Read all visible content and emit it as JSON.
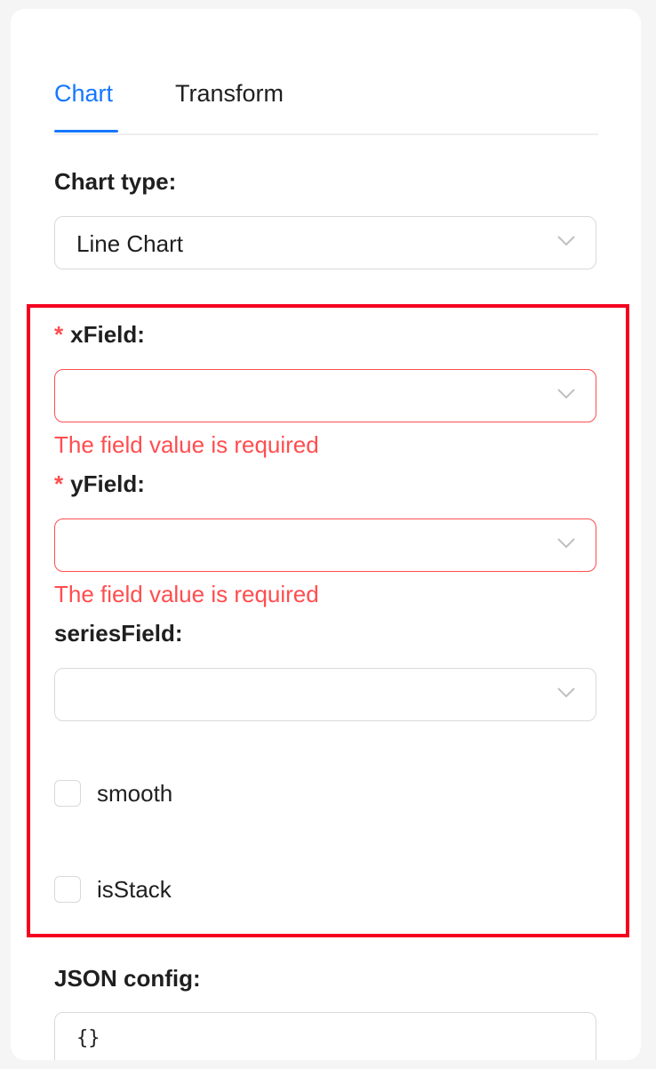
{
  "tabs": [
    {
      "label": "Chart",
      "active": true
    },
    {
      "label": "Transform",
      "active": false
    }
  ],
  "chart_type": {
    "label": "Chart type",
    "colon": ":",
    "value": "Line Chart"
  },
  "x_field": {
    "required_mark": "*",
    "label": "xField",
    "colon": ":",
    "value": "",
    "error": "The field value is required"
  },
  "y_field": {
    "required_mark": "*",
    "label": "yField",
    "colon": ":",
    "value": "",
    "error": "The field value is required"
  },
  "series_field": {
    "label": "seriesField",
    "colon": ":",
    "value": ""
  },
  "checkboxes": [
    {
      "label": "smooth",
      "checked": false
    },
    {
      "label": "isStack",
      "checked": false
    }
  ],
  "json_config": {
    "label": "JSON config",
    "colon": ":",
    "value": "{}"
  },
  "colors": {
    "accent": "#1677ff",
    "error": "#ff4d4f",
    "highlight": "#f5001f"
  }
}
